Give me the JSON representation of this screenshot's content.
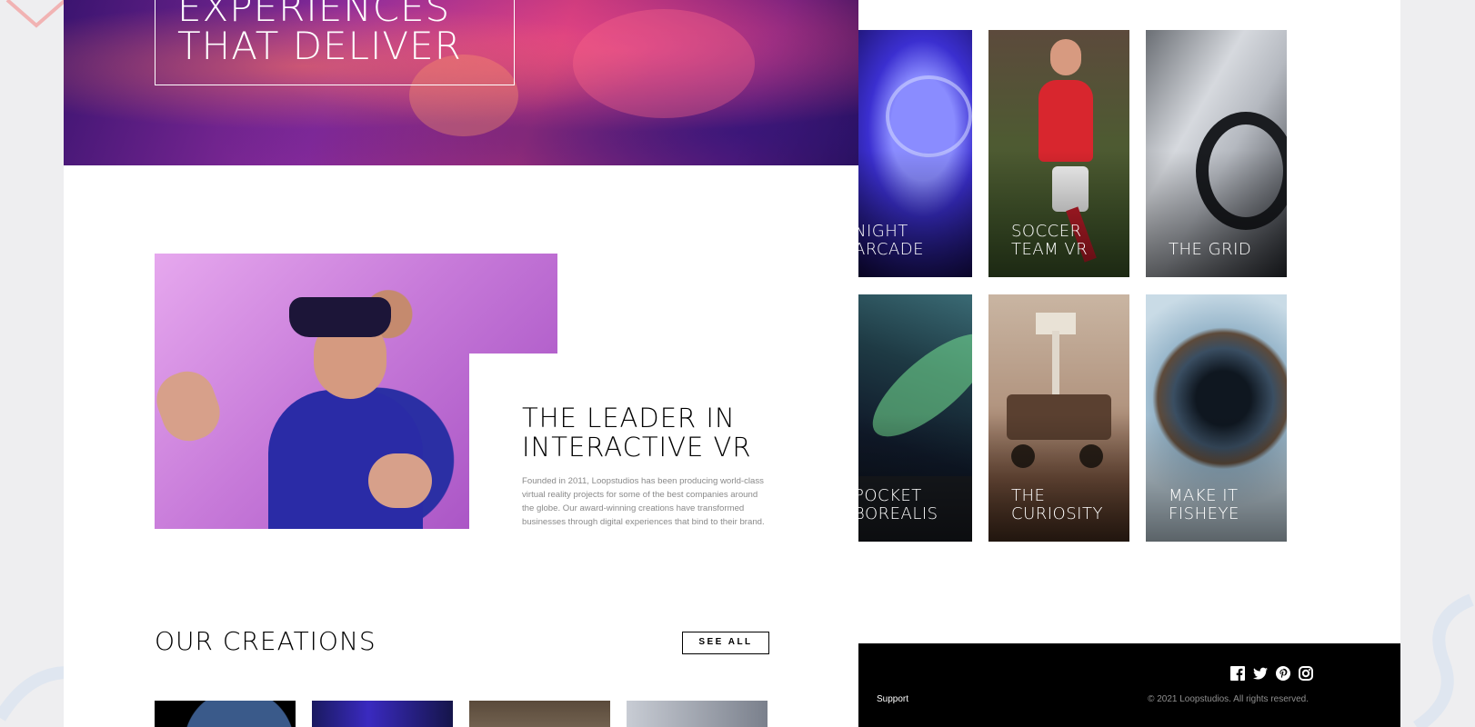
{
  "hero": {
    "title": "EXPERIENCES THAT DELIVER"
  },
  "about": {
    "title": "THE LEADER IN INTERACTIVE VR",
    "text": "Founded in 2011, Loopstudios has been producing world-class virtual reality projects for some of the best companies around the globe. Our award-winning creations have transformed businesses through digital experiences that bind to their brand."
  },
  "creations": {
    "title": "OUR CREATIONS",
    "see_all": "SEE ALL"
  },
  "cards": [
    {
      "label": "NIGHT ARCADE"
    },
    {
      "label": "SOCCER TEAM VR"
    },
    {
      "label": "THE GRID"
    },
    {
      "label": "POCKET BOREALIS"
    },
    {
      "label": "THE CURIOSITY"
    },
    {
      "label": "MAKE IT FISHEYE"
    }
  ],
  "footer": {
    "link": "Support",
    "copyright": "© 2021 Loopstudios. All rights reserved.",
    "social_icons": [
      "facebook-icon",
      "twitter-icon",
      "pinterest-icon",
      "instagram-icon"
    ]
  },
  "colors": {
    "background": "#eeeef0",
    "footer": "#000000",
    "text_muted": "#8a8a8a"
  }
}
